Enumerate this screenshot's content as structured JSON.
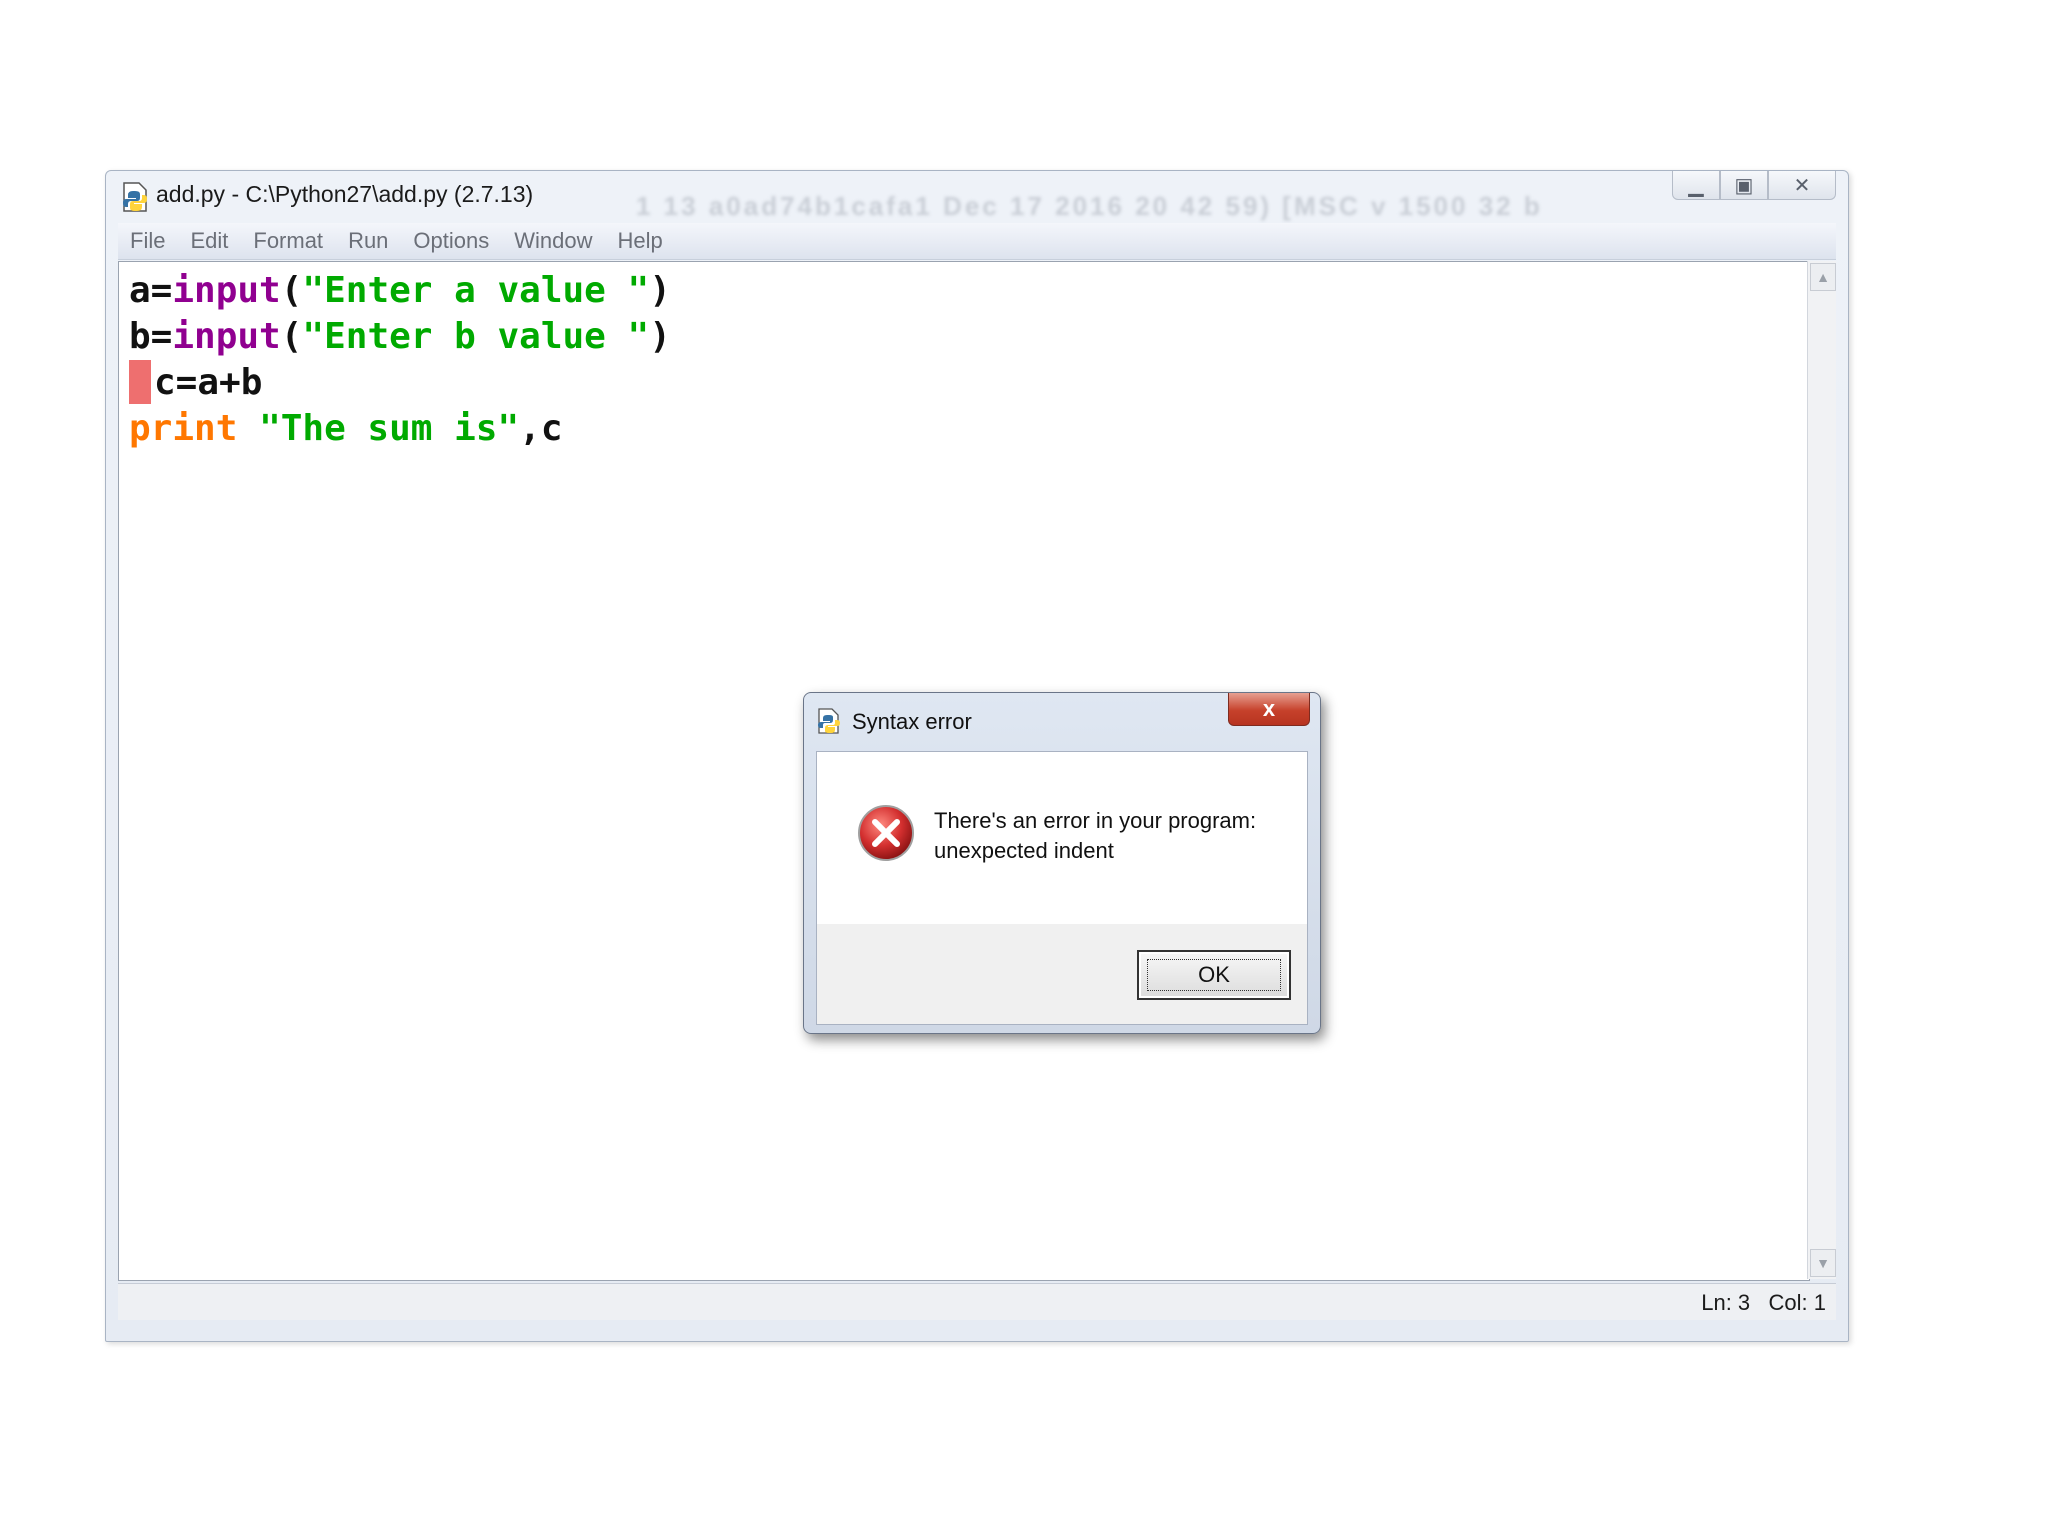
{
  "window": {
    "title": "add.py - C:\\Python27\\add.py (2.7.13)",
    "title_ghost": "1 13 a0ad74b1cafa1 Dec 17 2016 20 42 59) [MSC v 1500 32 b"
  },
  "menu": {
    "items": [
      "File",
      "Edit",
      "Format",
      "Run",
      "Options",
      "Window",
      "Help"
    ]
  },
  "editor": {
    "lines": [
      [
        {
          "text": "a=",
          "cls": ""
        },
        {
          "text": "input",
          "cls": "kw-builtin"
        },
        {
          "text": "(",
          "cls": ""
        },
        {
          "text": "\"Enter a value \"",
          "cls": "str"
        },
        {
          "text": ")",
          "cls": ""
        }
      ],
      [
        {
          "text": "b=",
          "cls": ""
        },
        {
          "text": "input",
          "cls": "kw-builtin"
        },
        {
          "text": "(",
          "cls": ""
        },
        {
          "text": "\"Enter b value \"",
          "cls": "str"
        },
        {
          "text": ")",
          "cls": ""
        }
      ],
      [
        {
          "text": "c=a+b",
          "cls": "",
          "error_marker": true
        }
      ],
      [
        {
          "text": "print",
          "cls": "kw"
        },
        {
          "text": " ",
          "cls": ""
        },
        {
          "text": "\"The sum is\"",
          "cls": "str"
        },
        {
          "text": ",c",
          "cls": ""
        }
      ]
    ],
    "colors": {
      "builtin": "#900090",
      "string": "#00aa00",
      "keyword": "#ff7700",
      "error_mark": "#ee6f6f"
    }
  },
  "status": {
    "ln": "Ln: 3",
    "col": "Col: 1"
  },
  "dialog": {
    "title": "Syntax error",
    "close_label": "x",
    "message_line1": "There's an error in your program:",
    "message_line2": "unexpected indent",
    "ok_label": "OK"
  }
}
